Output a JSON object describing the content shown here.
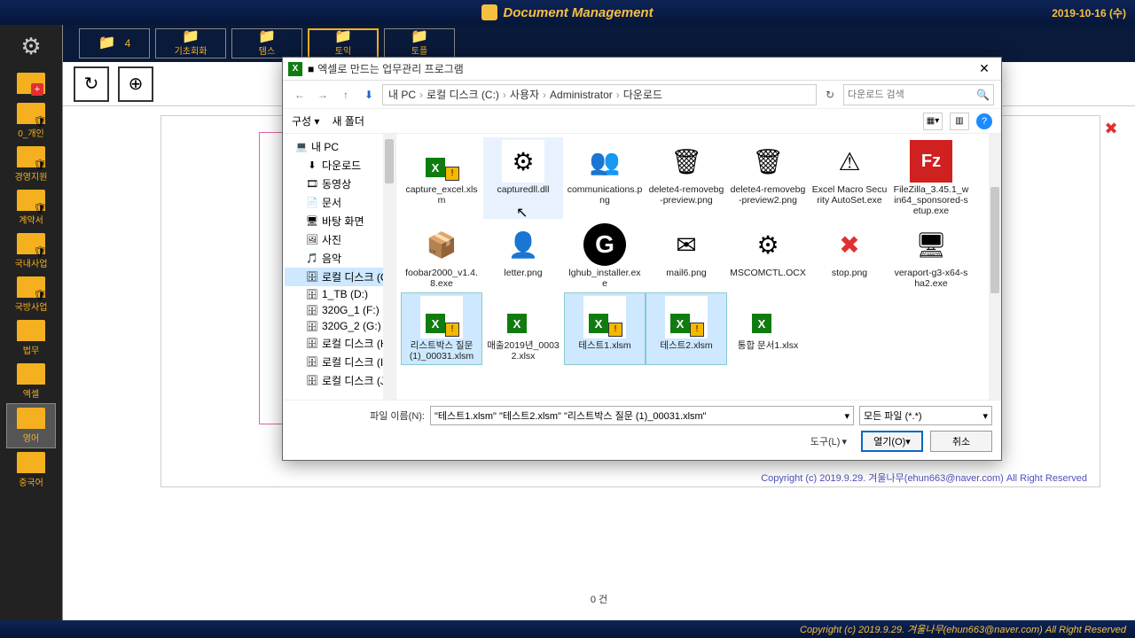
{
  "titlebar": {
    "title": "Document Management",
    "date": "2019-10-16 (수)"
  },
  "sidebar": {
    "items": [
      {
        "label": "",
        "type": "add"
      },
      {
        "label": "0_개인",
        "type": "shield"
      },
      {
        "label": "경영지원",
        "type": "shield"
      },
      {
        "label": "계약서",
        "type": "shield"
      },
      {
        "label": "국내사업",
        "type": "shield"
      },
      {
        "label": "국방사업",
        "type": "shield"
      },
      {
        "label": "법무",
        "type": "plain"
      },
      {
        "label": "엑셀",
        "type": "plain"
      },
      {
        "label": "영어",
        "type": "plain",
        "selected": true
      },
      {
        "label": "중국어",
        "type": "plain"
      }
    ]
  },
  "tabs": [
    {
      "label": "",
      "count": "4"
    },
    {
      "label": "기초회화"
    },
    {
      "label": "템스"
    },
    {
      "label": "토익"
    },
    {
      "label": "토플"
    }
  ],
  "copyright": "Copyright (c) 2019.9.29. 겨울나무(ehun663@naver.com)  All Right Reserved",
  "footer_count": "0     건",
  "dialog": {
    "title": "엑셀로 만드는 업무관리 프로그램",
    "crumbs": [
      "내 PC",
      "로컬 디스크 (C:)",
      "사용자",
      "Administrator",
      "다운로드"
    ],
    "search_placeholder": "다운로드 검색",
    "organize": "구성 ▾",
    "newfolder": "새 폴더",
    "tree": [
      {
        "label": "내 PC",
        "icon": "💻",
        "lvl": 1
      },
      {
        "label": "다운로드",
        "icon": "⬇",
        "lvl": 2
      },
      {
        "label": "동영상",
        "icon": "🎞",
        "lvl": 2
      },
      {
        "label": "문서",
        "icon": "📄",
        "lvl": 2
      },
      {
        "label": "바탕 화면",
        "icon": "🖥",
        "lvl": 2
      },
      {
        "label": "사진",
        "icon": "🖼",
        "lvl": 2
      },
      {
        "label": "음악",
        "icon": "🎵",
        "lvl": 2
      },
      {
        "label": "로컬 디스크 (C:)",
        "icon": "🗄",
        "lvl": 2,
        "sel": true
      },
      {
        "label": "1_TB (D:)",
        "icon": "🗄",
        "lvl": 2
      },
      {
        "label": "320G_1 (F:)",
        "icon": "🗄",
        "lvl": 2
      },
      {
        "label": "320G_2 (G:)",
        "icon": "🗄",
        "lvl": 2
      },
      {
        "label": "로컬 디스크 (H:)",
        "icon": "🗄",
        "lvl": 2
      },
      {
        "label": "로컬 디스크 (I:)",
        "icon": "🗄",
        "lvl": 2
      },
      {
        "label": "로컬 디스크 (J:)",
        "icon": "🗄",
        "lvl": 2
      }
    ],
    "files": [
      {
        "name": "capture_excel.xlsm",
        "icon": "excel-warn"
      },
      {
        "name": "capturedll.dll",
        "icon": "⚙",
        "hover": true
      },
      {
        "name": "communications.png",
        "icon": "👥"
      },
      {
        "name": "delete4-removebg-preview.png",
        "icon": "🗑"
      },
      {
        "name": "delete4-removebg-preview2.png",
        "icon": "🗑"
      },
      {
        "name": "Excel Macro Security AutoSet.exe",
        "icon": "⚠"
      },
      {
        "name": "FileZilla_3.45.1_win64_sponsored-setup.exe",
        "icon": "Fz"
      },
      {
        "name": "foobar2000_v1.4.8.exe",
        "icon": "📦"
      },
      {
        "name": "letter.png",
        "icon": "👤"
      },
      {
        "name": "lghub_installer.exe",
        "icon": "G"
      },
      {
        "name": "mail6.png",
        "icon": "✉"
      },
      {
        "name": "MSCOMCTL.OCX",
        "icon": "⚙"
      },
      {
        "name": "stop.png",
        "icon": "✖"
      },
      {
        "name": "veraport-g3-x64-sha2.exe",
        "icon": "🖥"
      },
      {
        "name": "리스트박스 질문 (1)_00031.xlsm",
        "icon": "excel-warn",
        "sel": true
      },
      {
        "name": "매출2019년_00032.xlsx",
        "icon": "excel"
      },
      {
        "name": "테스트1.xlsm",
        "icon": "excel-warn",
        "sel": true
      },
      {
        "name": "테스트2.xlsm",
        "icon": "excel-warn",
        "sel": true
      },
      {
        "name": "통합 문서1.xlsx",
        "icon": "excel"
      }
    ],
    "filename_label": "파일 이름(N):",
    "filename_value": "\"테스트1.xlsm\" \"테스트2.xlsm\" \"리스트박스 질문 (1)_00031.xlsm\"",
    "filter": "모든 파일 (*.*)",
    "tools": "도구(L)",
    "open": "열기(O)",
    "cancel": "취소"
  }
}
